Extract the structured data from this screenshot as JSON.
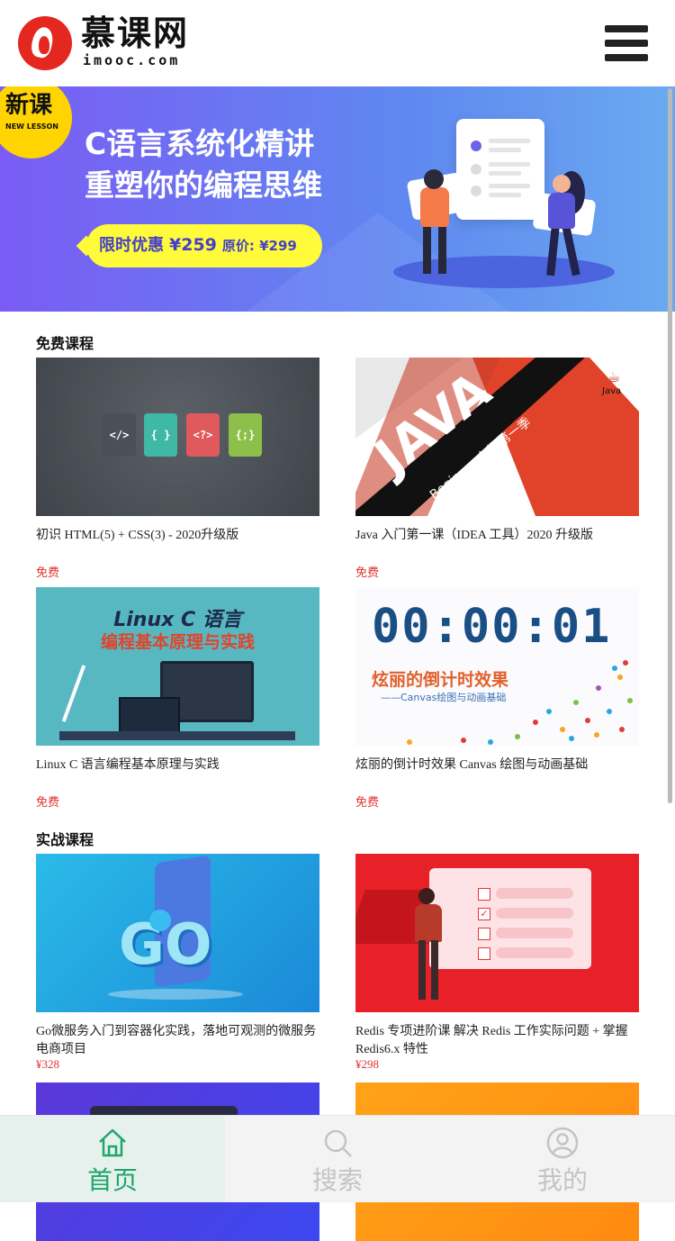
{
  "header": {
    "logo_name": "慕课网",
    "logo_domain": "imooc.com",
    "menu_icon": "hamburger-menu-icon"
  },
  "banner": {
    "badge_main": "新课",
    "badge_sub": "NEW LESSON",
    "title_line1": "C语言系统化精讲",
    "title_line2": "重塑你的编程思维",
    "promo_label": "限时优惠",
    "promo_price": "¥259",
    "promo_original": "原价: ¥299"
  },
  "sections": {
    "free_title": "免费课程",
    "practical_title": "实战课程"
  },
  "free_courses": [
    {
      "title": "初识 HTML(5) + CSS(3) - 2020升级版",
      "price": "免费"
    },
    {
      "title": "Java 入门第一课（IDEA 工具）2020 升级版",
      "price": "免费"
    },
    {
      "title": "Linux C 语言编程基本原理与实践",
      "price": "免费"
    },
    {
      "title": "炫丽的倒计时效果 Canvas 绘图与动画基础",
      "price": "免费"
    }
  ],
  "practical_courses": [
    {
      "title": "Go微服务入门到容器化实践，落地可观测的微服务电商项目",
      "price": "¥328"
    },
    {
      "title": "Redis 专项进阶课 解决 Redis 工作实际问题 + 掌握Redis6.x 特性",
      "price": "¥298"
    }
  ],
  "thumb_text": {
    "html_icons": [
      "</>",
      "{ }",
      "<?>",
      "{;}"
    ],
    "java_big": "JAVA",
    "java_sub": "Beginner 入门第一季",
    "java_logo": "Java",
    "linux_title": "Linux C 语言",
    "linux_sub": "编程基本原理与实践",
    "countdown_digits": "00:00:01",
    "countdown_title": "炫丽的倒计时效果",
    "countdown_sub": "——Canvas绘图与动画基础",
    "go_logo": "GO"
  },
  "colors": {
    "brand_red": "#e4281f",
    "price_red": "#e0322e",
    "tab_active": "#1fa66a",
    "tab_inactive": "#c4c4c4"
  },
  "tabbar": [
    {
      "label": "首页",
      "icon": "home-icon",
      "active": true
    },
    {
      "label": "搜索",
      "icon": "search-icon",
      "active": false
    },
    {
      "label": "我的",
      "icon": "user-icon",
      "active": false
    }
  ]
}
